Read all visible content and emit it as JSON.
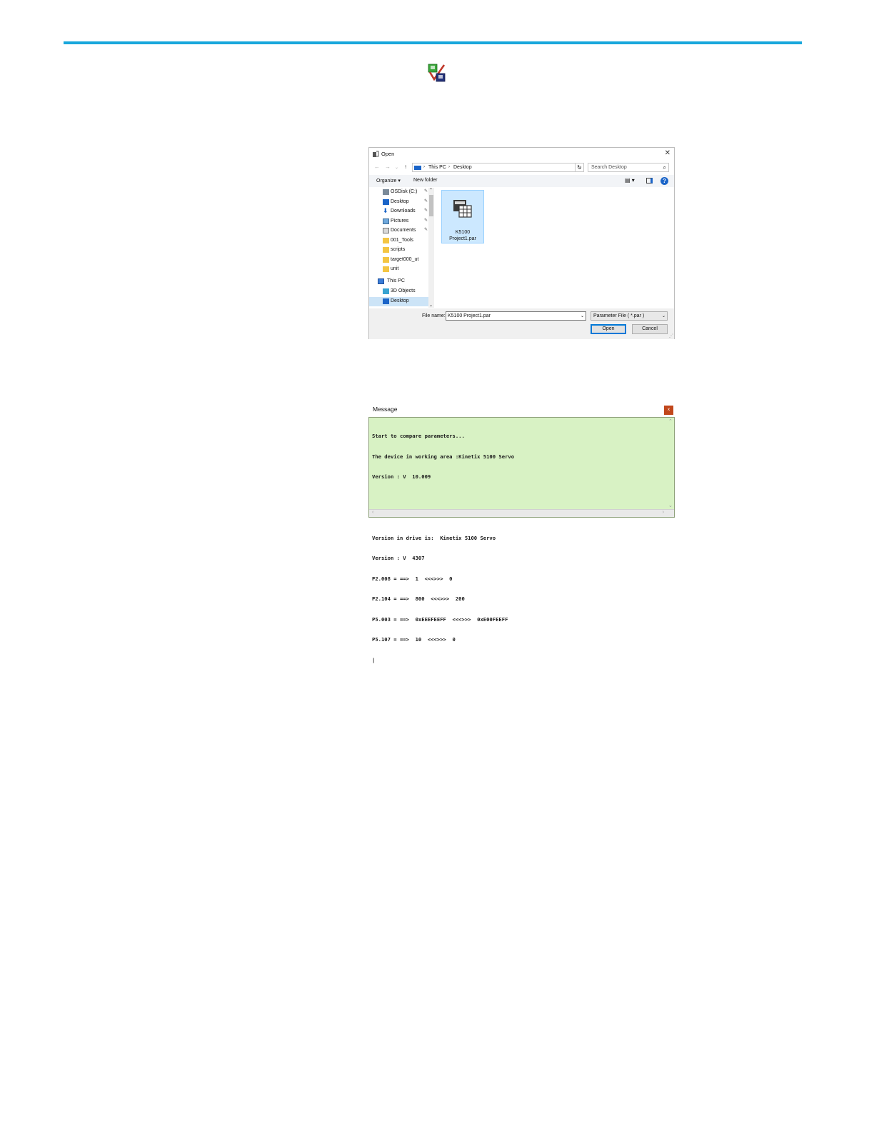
{
  "colors": {
    "accent_rule": "#18a7dc",
    "message_bg": "#d8f2c4",
    "message_close": "#c1471b",
    "selection": "#cce8ff"
  },
  "compare_icon": {
    "name": "compare-parameters-icon"
  },
  "open_dialog": {
    "title": "Open",
    "close_glyph": "✕",
    "address": {
      "segments": [
        "This PC",
        "Desktop"
      ]
    },
    "search_placeholder": "Search Desktop",
    "toolbar": {
      "organize": "Organize ▾",
      "new_folder": "New folder"
    },
    "nav_items": [
      {
        "label": "OSDisk (C:)",
        "icon": "drive-icon",
        "pinned": true
      },
      {
        "label": "Desktop",
        "icon": "desktop-icon",
        "pinned": true
      },
      {
        "label": "Downloads",
        "icon": "downloads-icon",
        "pinned": true
      },
      {
        "label": "Pictures",
        "icon": "pictures-icon",
        "pinned": true
      },
      {
        "label": "Documents",
        "icon": "documents-icon",
        "pinned": true
      },
      {
        "label": "001_Tools",
        "icon": "folder-icon",
        "pinned": false
      },
      {
        "label": "scripts",
        "icon": "folder-icon",
        "pinned": false
      },
      {
        "label": "target000_ut",
        "icon": "folder-icon",
        "pinned": false
      },
      {
        "label": "unit",
        "icon": "folder-icon",
        "pinned": false
      },
      {
        "label": "This PC",
        "icon": "computer-icon",
        "pinned": false
      },
      {
        "label": "3D Objects",
        "icon": "3d-objects-icon",
        "pinned": false
      },
      {
        "label": "Desktop",
        "icon": "desktop-icon",
        "pinned": false,
        "selected": true
      }
    ],
    "file": {
      "name_line1": "K5100",
      "name_line2": "Project1.par"
    },
    "file_name_label": "File name:",
    "file_name_value": "K5100 Project1.par",
    "file_type": "Parameter File ( *.par )",
    "open_button": "Open",
    "cancel_button": "Cancel"
  },
  "message": {
    "title": "Message",
    "close_glyph": "x",
    "lines": [
      "Start to compare parameters...",
      "The device in working area :Kinetix 5100 Servo",
      "Version : V  10.009",
      "",
      "",
      "Version in drive is:  Kinetix 5100 Servo",
      "Version : V  4307",
      "P2.008 = ==>  1  <<<>>>  0",
      "P2.104 = ==>  800  <<<>>>  200",
      "P5.003 = ==>  0xEEEFEEFF  <<<>>>  0xE00FEEFF",
      "P5.107 = ==>  10  <<<>>>  0",
      "|"
    ]
  }
}
